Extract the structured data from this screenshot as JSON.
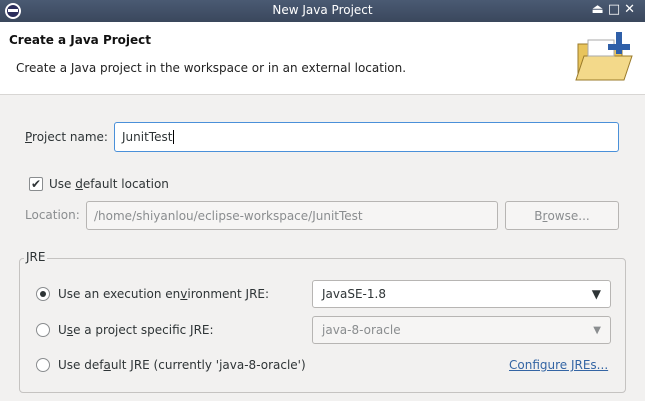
{
  "window": {
    "title": "New Java Project",
    "controls": "⏏□✕"
  },
  "header": {
    "title": "Create a Java Project",
    "description": "Create a Java project in the workspace or in an external location."
  },
  "project_name": {
    "label_prefix": "P",
    "label_rest": "roject name:",
    "value": "JunitTest"
  },
  "default_location": {
    "label_pre": "Use ",
    "label_mn": "d",
    "label_post": "efault location",
    "checked": true
  },
  "location": {
    "label": "Location:",
    "value": "/home/shiyanlou/eclipse-workspace/JunitTest",
    "browse_pre": "B",
    "browse_mn": "r",
    "browse_post": "owse..."
  },
  "jre": {
    "legend": "JRE",
    "opt1_pre": "Use an execution en",
    "opt1_mn": "v",
    "opt1_post": "ironment JRE:",
    "opt1_value": "JavaSE-1.8",
    "opt2_pre": "U",
    "opt2_mn": "s",
    "opt2_post": "e a project specific JRE:",
    "opt2_value": "java-8-oracle",
    "opt3_pre": "Use def",
    "opt3_mn": "a",
    "opt3_post": "ult JRE (currently 'java-8-oracle')",
    "configure_link": "Configure JREs..."
  }
}
